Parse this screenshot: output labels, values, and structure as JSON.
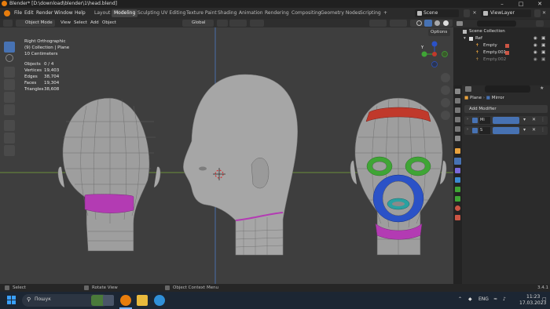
{
  "window": {
    "title": "Blender* [D:\\download\\blender\\1\\head.blend]"
  },
  "menubar": {
    "items": [
      "File",
      "Edit",
      "Render",
      "Window",
      "Help"
    ]
  },
  "workspaces": [
    "Layout",
    "Modeling",
    "Sculpting",
    "UV Editing",
    "Texture Paint",
    "Shading",
    "Animation",
    "Rendering",
    "Compositing",
    "Geometry Nodes",
    "Scripting"
  ],
  "active_workspace": "Modeling",
  "scene_selector": "Scene",
  "viewlayer_selector": "ViewLayer",
  "viewport_header": {
    "mode": "Object Mode",
    "menus": [
      "View",
      "Select",
      "Add",
      "Object"
    ],
    "transform_orientation": "Global",
    "options_label": "Options"
  },
  "viewport_overlay": {
    "view_name": "Right Orthographic",
    "collection_line": "(9) Collection | Plane",
    "scale_line": "10 Centimeters",
    "stats": [
      {
        "label": "Objects",
        "value": "0 / 4"
      },
      {
        "label": "Vertices",
        "value": "19,403"
      },
      {
        "label": "Edges",
        "value": "38,704"
      },
      {
        "label": "Faces",
        "value": "19,304"
      },
      {
        "label": "Triangles",
        "value": "38,608"
      }
    ]
  },
  "gizmo_axes": {
    "x": "X",
    "y": "Y",
    "z": "Z"
  },
  "outliner": {
    "root": "Scene Collection",
    "collection": "Ref",
    "items": [
      "Empty",
      "Empty.001",
      "Empty.002"
    ]
  },
  "properties": {
    "breadcrumb_object": "Plane",
    "breadcrumb_modifier": "Mirror",
    "add_modifier_label": "Add Modifier",
    "modifiers": [
      "Mi",
      "S"
    ]
  },
  "statusbar": {
    "left": "Select",
    "middle": "Rotate View",
    "right": "Object Context Menu",
    "version": "3.4.1"
  },
  "taskbar": {
    "search_placeholder": "Пошук",
    "language": "ENG",
    "time": "11:23",
    "date": "17.03.2023"
  },
  "colors": {
    "accent": "#4772b3",
    "active_tool": "#4772b3",
    "viewport_bg": "#3e3e3e",
    "mesh_band_magenta": "#b33bb3",
    "mesh_band_red": "#c0392b",
    "mesh_band_green": "#3fa535",
    "mesh_band_blue": "#2b52c7",
    "mesh_band_teal": "#2aa1a1"
  }
}
